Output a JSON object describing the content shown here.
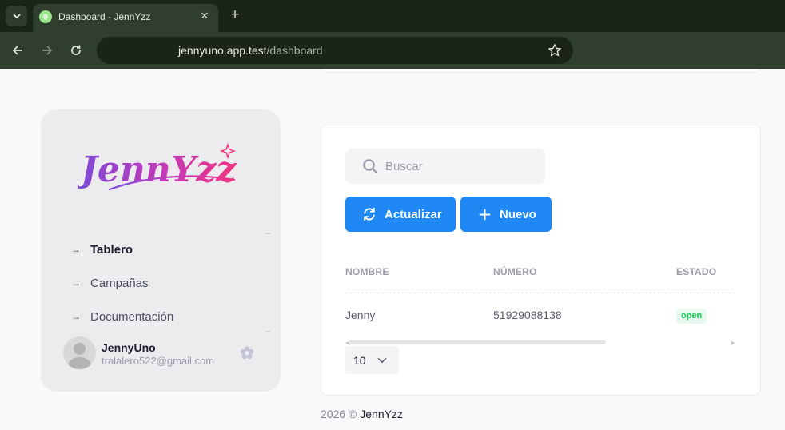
{
  "browser": {
    "tab_title": "Dashboard - JennYzz",
    "url_host": "jennyuno.app.test",
    "url_path": "/dashboard",
    "accent_bg": "#303e2d"
  },
  "sidebar": {
    "logo_text": "JennYzz",
    "nav": [
      {
        "label": "Tablero",
        "active": true
      },
      {
        "label": "Campañas",
        "active": false
      },
      {
        "label": "Documentación",
        "active": false
      }
    ],
    "user": {
      "name": "JennyUno",
      "email": "tralalero522@gmail.com"
    }
  },
  "main": {
    "search_placeholder": "Buscar",
    "refresh_label": "Actualizar",
    "new_label": "Nuevo",
    "primary_color": "#1f88f5",
    "table": {
      "headers": [
        "NOMBRE",
        "NÚMERO",
        "ESTADO"
      ],
      "rows": [
        {
          "name": "Jenny",
          "number": "51929088138",
          "status": "open"
        }
      ]
    },
    "page_size": "10"
  },
  "footer": {
    "year": "2026",
    "symbol": "©",
    "brand": "JennYzz"
  }
}
